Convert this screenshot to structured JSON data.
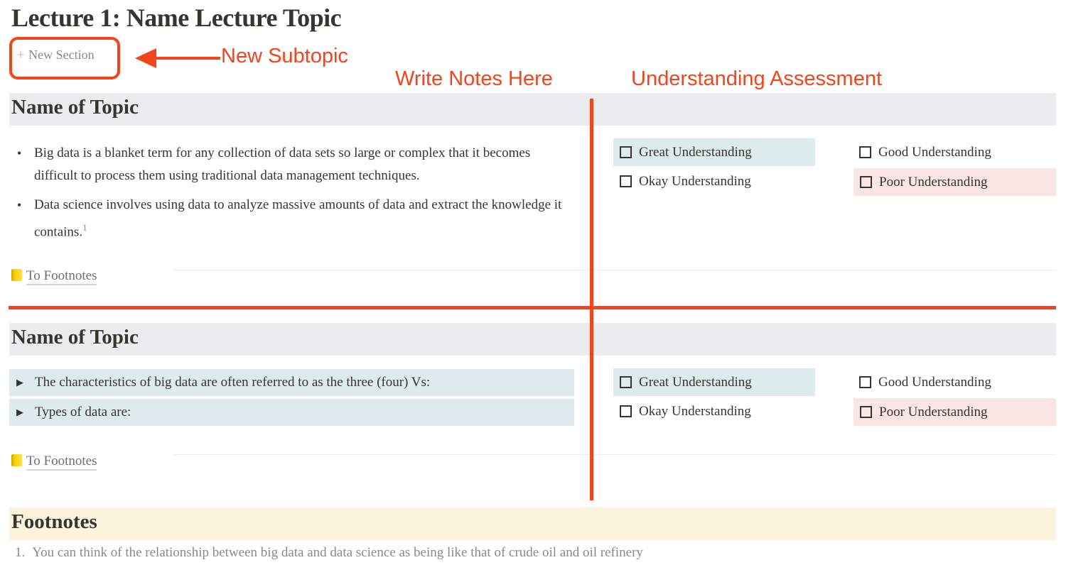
{
  "page": {
    "title": "Lecture 1: Name Lecture Topic",
    "new_section_icon": "plus-icon",
    "new_section_label": "New Section"
  },
  "annotations": {
    "new_subtopic": "New Subtopic",
    "write_notes": "Write Notes Here",
    "assessment": "Understanding Assessment",
    "color": "#f2441d"
  },
  "sections": [
    {
      "title": "Name of Topic",
      "notes_type": "bulleted",
      "notes": [
        "Big data is a blanket term for any collection of data sets so large or complex that it becomes difficult to process them using traditional data management techniques.",
        "Data science involves using data to analyze massive amounts of data and extract the knowledge it contains."
      ],
      "footnote_ref": "1",
      "footnote_link": "To Footnotes",
      "footnote_icon": "notebook-icon",
      "checkboxes": [
        {
          "label": "Great Understanding",
          "checked": false,
          "color": "#ddebea"
        },
        {
          "label": "Good Understanding",
          "checked": false
        },
        {
          "label": "Okay Understanding",
          "checked": false
        },
        {
          "label": "Poor Understanding",
          "checked": false,
          "color": "#fbe4e4"
        }
      ]
    },
    {
      "title": "Name of Topic",
      "notes_type": "toggles",
      "notes": [
        "The characteristics of big data are often referred to as the three (four) Vs:",
        "Types of data are:"
      ],
      "footnote_link": "To Footnotes",
      "footnote_icon": "notebook-icon",
      "checkboxes": [
        {
          "label": "Great Understanding",
          "checked": false,
          "color": "#ddebea"
        },
        {
          "label": "Good Understanding",
          "checked": false
        },
        {
          "label": "Okay Understanding",
          "checked": false
        },
        {
          "label": "Poor Understanding",
          "checked": false,
          "color": "#fbe4e4"
        }
      ]
    }
  ],
  "footnotes": {
    "title": "Footnotes",
    "items": [
      {
        "num": "1.",
        "text": "You can think of the relationship between big data and data science as being like that of crude oil and oil refinery"
      }
    ]
  }
}
